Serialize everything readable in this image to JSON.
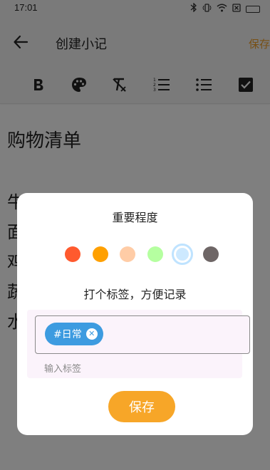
{
  "status_bar": {
    "time": "17:01",
    "icons": [
      "bluetooth-icon",
      "vibrate-icon",
      "wifi-icon",
      "sim-off-icon",
      "battery-icon"
    ]
  },
  "header": {
    "title": "创建小记",
    "save_label": "保存"
  },
  "toolbar": {
    "tools": [
      "bold-icon",
      "palette-icon",
      "clear-format-icon",
      "numbered-list-icon",
      "bullet-list-icon",
      "checkbox-icon"
    ]
  },
  "note": {
    "title": "购物清单",
    "lines": [
      "牛奶",
      "面包",
      "鸡蛋",
      "蔬菜",
      "水果"
    ]
  },
  "dialog": {
    "importance_title": "重要程度",
    "importance_colors": [
      "#ff5a2e",
      "#ffa000",
      "#ffcca6",
      "#b5ffa0",
      "#cde9ff",
      "#6e6666"
    ],
    "selected_color_index": 4,
    "tag_title": "打个标签，方便记录",
    "tags": [
      {
        "label": "#日常"
      }
    ],
    "tag_input_placeholder": "输入标签",
    "save_label": "保存"
  },
  "colors": {
    "accent": "#f7a628",
    "chip": "#3d9be0"
  }
}
